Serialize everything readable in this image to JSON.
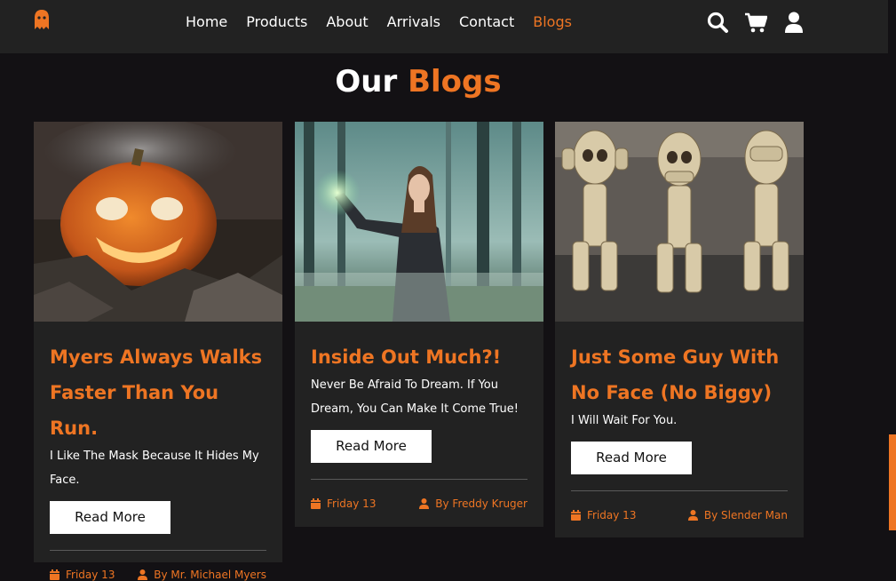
{
  "nav": {
    "items": [
      "Home",
      "Products",
      "About",
      "Arrivals",
      "Contact",
      "Blogs"
    ],
    "active": "Blogs"
  },
  "header_icons": [
    "search-icon",
    "cart-icon",
    "user-icon"
  ],
  "heading": {
    "part1": "Our",
    "part2": "Blogs"
  },
  "cards": [
    {
      "image": "jack-o-lantern",
      "title": "Myers Always Walks Faster Than You Run.",
      "text": "I Like The Mask Because It Hides My Face.",
      "button": "Read More",
      "date": "Friday 13",
      "author": "By Mr. Michael Myers"
    },
    {
      "image": "witch-in-forest",
      "title": "Inside Out Much?!",
      "text": "Never Be Afraid To Dream. If You Dream, You Can Make It Come True!",
      "button": "Read More",
      "date": "Friday 13",
      "author": "By Freddy Kruger"
    },
    {
      "image": "skeleton-figurines",
      "title": "Just Some Guy With No Face (No Biggy)",
      "text": "I Will Wait For You.",
      "button": "Read More",
      "date": "Friday 13",
      "author": "By Slender Man"
    }
  ],
  "colors": {
    "accent": "#ee7523",
    "background": "#131114",
    "card": "#222222"
  }
}
